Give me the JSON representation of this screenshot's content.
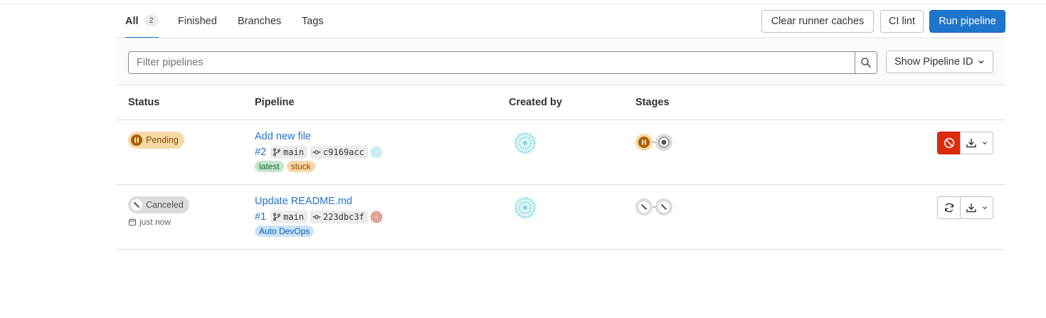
{
  "tabs": [
    {
      "label": "All",
      "count": "2"
    },
    {
      "label": "Finished"
    },
    {
      "label": "Branches"
    },
    {
      "label": "Tags"
    }
  ],
  "header_buttons": {
    "clear_caches": "Clear runner caches",
    "ci_lint": "CI lint",
    "run_pipeline": "Run pipeline"
  },
  "filter": {
    "placeholder": "Filter pipelines",
    "show_id_label": "Show Pipeline ID"
  },
  "columns": {
    "status": "Status",
    "pipeline": "Pipeline",
    "created_by": "Created by",
    "stages": "Stages"
  },
  "pipelines": [
    {
      "status": "Pending",
      "title": "Add new file",
      "id": "#2",
      "branch": "main",
      "commit": "c9169acc",
      "tags": [
        "latest",
        "stuck"
      ],
      "stages": [
        "pending",
        "created"
      ],
      "action": "cancel"
    },
    {
      "status": "Canceled",
      "time": "just now",
      "title": "Update README.md",
      "id": "#1",
      "branch": "main",
      "commit": "223dbc3f",
      "tags": [
        "Auto DevOps"
      ],
      "stages": [
        "canceled",
        "canceled"
      ],
      "action": "retry"
    }
  ],
  "colors": {
    "primary": "#1f75cb",
    "pending": "#ab6100",
    "danger": "#dd2b0e",
    "canceled": "#535158"
  }
}
